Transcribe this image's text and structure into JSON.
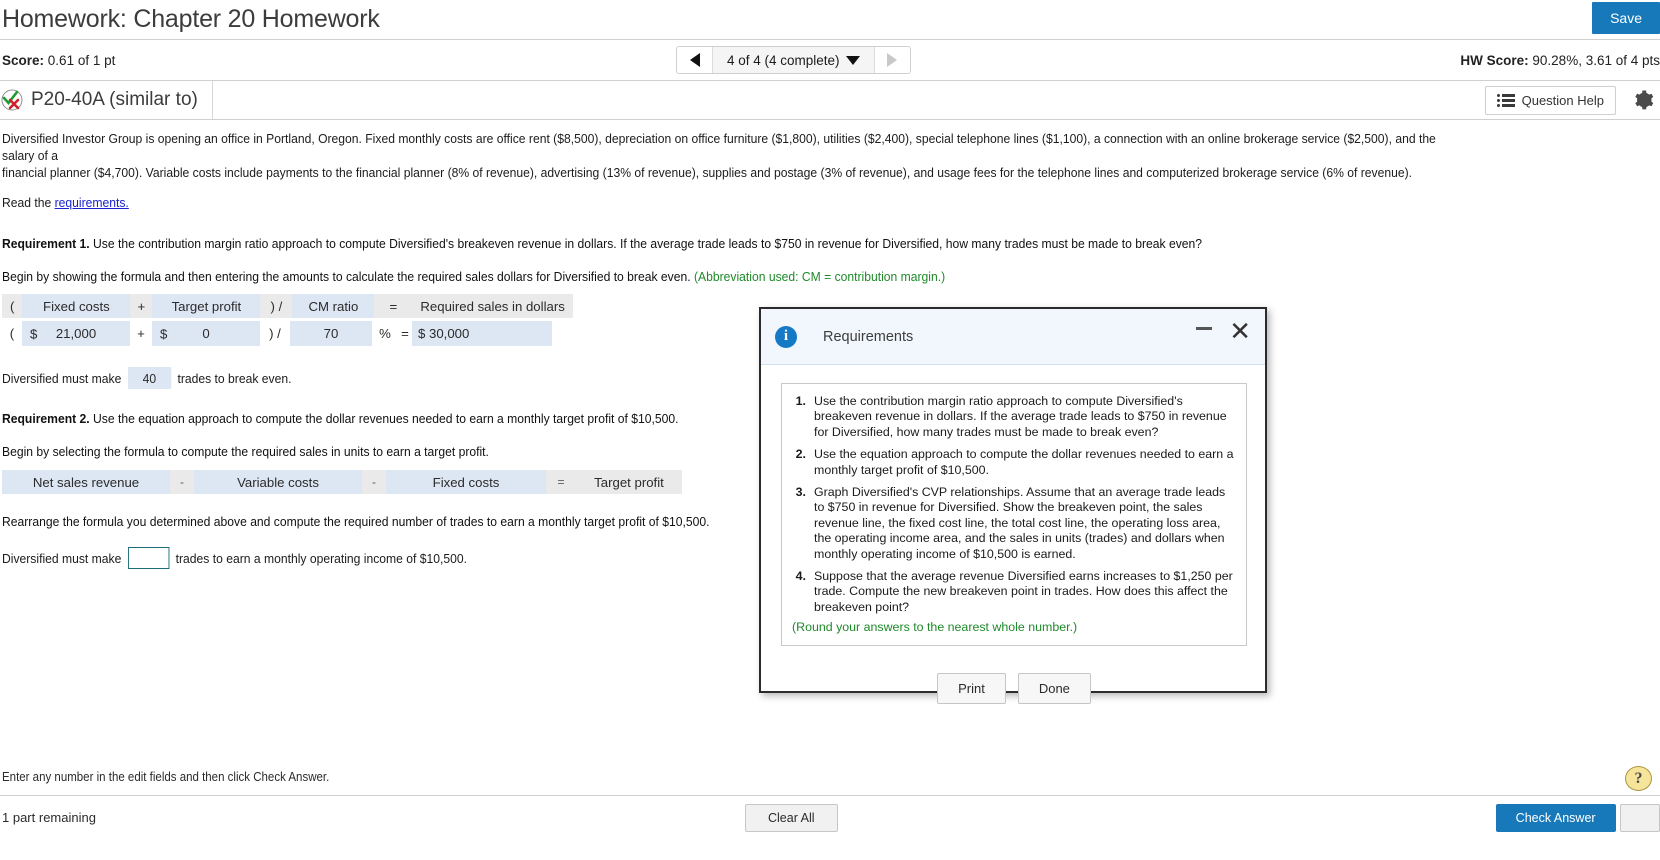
{
  "header": {
    "title": "Homework: Chapter 20 Homework",
    "save_label": "Save"
  },
  "scorebar": {
    "score_label": "Score:",
    "score_value": "0.61 of 1 pt",
    "nav_text": "4 of 4 (4 complete)",
    "hw_score_label": "HW Score:",
    "hw_score_value": "90.28%, 3.61 of 4 pts"
  },
  "problem": {
    "id": "P20-40A (similar to)",
    "question_help": "Question Help",
    "status_icon": "check-x-icon",
    "gear_icon": "gear-icon"
  },
  "body": {
    "paragraph_line1": "Diversified Investor Group is opening an office in Portland, Oregon. Fixed monthly costs are office rent ($8,500), depreciation on office furniture ($1,800), utilities ($2,400), special telephone lines ($1,100), a connection with an online brokerage service ($2,500), and the salary of a",
    "paragraph_line2": "financial planner ($4,700). Variable costs include payments to the financial planner (8% of revenue), advertising (13% of revenue), supplies and postage (3% of revenue), and usage fees for the telephone lines and computerized brokerage service (6% of revenue).",
    "read_prefix": "Read the",
    "read_link": "requirements."
  },
  "requirement1": {
    "label": "Requirement 1.",
    "text": "Use the contribution margin ratio approach to compute Diversified's breakeven revenue in dollars. If the average trade leads to $750 in revenue for Diversified, how many trades must be made to break even?",
    "instruction": "Begin by showing the formula and then entering the amounts to calculate the required sales dollars for Diversified to break even.",
    "abbrev_note": "(Abbreviation used: CM = contribution margin.)",
    "formula_headers": {
      "open_paren": "(",
      "fixed_costs": "Fixed costs",
      "plus": "+",
      "target_profit": "Target profit",
      "close_divide": ") /",
      "cm_ratio": "CM ratio",
      "equals": "=",
      "required_sales": "Required sales in dollars"
    },
    "formula_values": {
      "open_paren": "(",
      "fixed_costs_symbol": "$",
      "fixed_costs": "21,000",
      "plus": "+",
      "target_profit_symbol": "$",
      "target_profit": "0",
      "close_divide": ") /",
      "cm_ratio": "70",
      "percent": "%",
      "equals": "=",
      "required_sales_symbol": "$",
      "required_sales": "30,000"
    },
    "trades_prefix": "Diversified must make",
    "trades_value": "40",
    "trades_suffix": "trades to break even."
  },
  "requirement2": {
    "label": "Requirement 2.",
    "text": "Use the equation approach to compute the dollar revenues needed to earn a monthly target profit of $10,500.",
    "instruction": "Begin by selecting the formula to compute the required sales in units to earn a target profit.",
    "equation_cells": {
      "net_sales_revenue": "Net sales revenue",
      "minus1": "-",
      "variable_costs": "Variable costs",
      "minus2": "-",
      "fixed_costs": "Fixed costs",
      "equals": "=",
      "target_profit": "Target profit"
    },
    "rearrange_text": "Rearrange the formula you determined above and compute the required number of trades to earn a monthly target profit of $10,500.",
    "trades_prefix": "Diversified must make",
    "trades_value": "",
    "trades_suffix": "trades to earn a monthly operating income of $10,500."
  },
  "modal": {
    "title": "Requirements",
    "info_icon": "info-icon",
    "minimize_icon": "minimize-icon",
    "close_icon": "close-icon",
    "items": [
      {
        "num": "1.",
        "text": "Use the contribution margin ratio approach to compute Diversified's breakeven revenue in dollars. If the average trade leads to $750 in revenue for Diversified, how many trades must be made to break even?"
      },
      {
        "num": "2.",
        "text": "Use the equation approach to compute the dollar revenues needed to earn a monthly target profit of $10,500."
      },
      {
        "num": "3.",
        "text": "Graph Diversified's CVP relationships. Assume that an average trade leads to $750 in revenue for Diversified. Show the breakeven point, the sales revenue line, the fixed cost line, the total cost line, the operating loss area, the operating income area, and the sales in units (trades) and dollars when monthly operating income of $10,500 is earned."
      },
      {
        "num": "4.",
        "text": "Suppose that the average revenue Diversified earns increases to $1,250 per trade. Compute the new breakeven point in trades. How does this affect the breakeven point?"
      }
    ],
    "round_note": "(Round your answers to the nearest whole number.)",
    "print_label": "Print",
    "done_label": "Done"
  },
  "footer": {
    "hint": "Enter any number in the edit fields and then click Check Answer.",
    "help_icon": "question-help-icon",
    "parts_label": "1 part",
    "remaining_label": "remaining",
    "check_answer_label": "Check Answer",
    "clear_all_label": "Clear All"
  },
  "colors": {
    "accent_blue": "#1779ba",
    "field_blue": "#dde6f3",
    "header_grey": "#eaeaea",
    "green_note": "#1f8a2a",
    "link_blue": "#1a23d0"
  }
}
